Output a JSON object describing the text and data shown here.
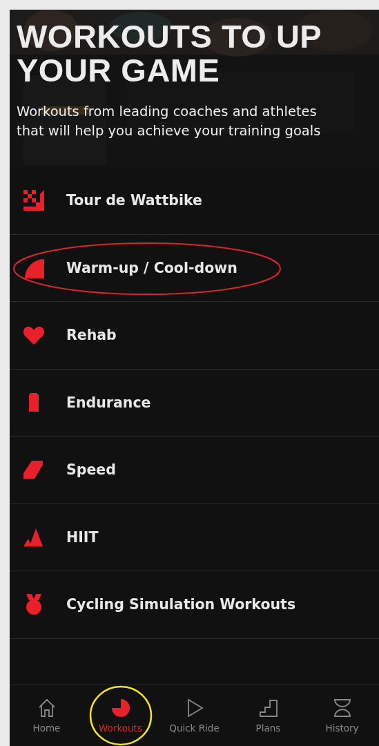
{
  "header": {
    "title": "WORKOUTS TO UP YOUR GAME",
    "subtitle": "Workouts from leading coaches and athletes that will help you achieve your training goals"
  },
  "categories": [
    {
      "label": "Tour de Wattbike",
      "kind": "flag",
      "circled": false
    },
    {
      "label": "Warm-up / Cool-down",
      "kind": "quarter",
      "circled": true
    },
    {
      "label": "Rehab",
      "kind": "heart",
      "circled": false
    },
    {
      "label": "Endurance",
      "kind": "battery",
      "circled": false
    },
    {
      "label": "Speed",
      "kind": "slash",
      "circled": false
    },
    {
      "label": "HIIT",
      "kind": "peaks",
      "circled": false
    },
    {
      "label": "Cycling Simulation Workouts",
      "kind": "medal",
      "circled": false
    }
  ],
  "tab_bar": [
    {
      "label": "Home",
      "kind": "home",
      "selected": false,
      "circled": false
    },
    {
      "label": "Workouts",
      "kind": "pie",
      "selected": true,
      "circled": true
    },
    {
      "label": "Quick Ride",
      "kind": "play",
      "selected": false,
      "circled": false
    },
    {
      "label": "Plans",
      "kind": "stairs",
      "selected": false,
      "circled": false
    },
    {
      "label": "History",
      "kind": "hourglass",
      "selected": false,
      "circled": false
    }
  ]
}
